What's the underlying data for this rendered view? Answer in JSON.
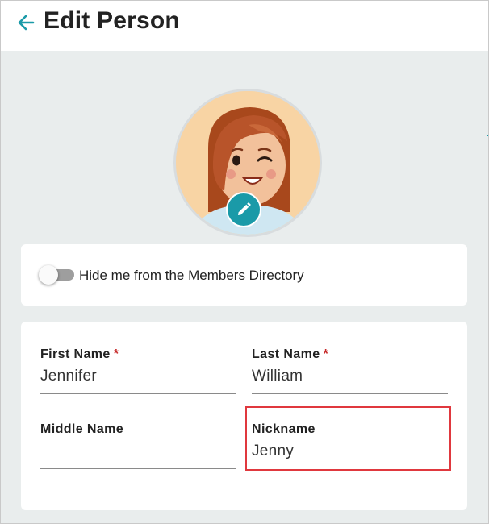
{
  "header": {
    "title": "Edit Person",
    "back_icon": "arrow-left-icon",
    "accent_color": "#1a9aa8"
  },
  "avatar": {
    "edit_icon": "pencil-icon"
  },
  "privacy": {
    "toggle_label": "Hide me from the Members Directory",
    "toggle_on": false
  },
  "fields": {
    "first_name": {
      "label": "First Name",
      "required": "*",
      "value": "Jennifer"
    },
    "last_name": {
      "label": "Last Name",
      "required": "*",
      "value": "William"
    },
    "middle_name": {
      "label": "Middle Name",
      "value": ""
    },
    "nickname": {
      "label": "Nickname",
      "value": "Jenny"
    }
  },
  "colors": {
    "required": "#c62828",
    "highlight": "#e0383e",
    "page_bg": "#e9eded"
  }
}
